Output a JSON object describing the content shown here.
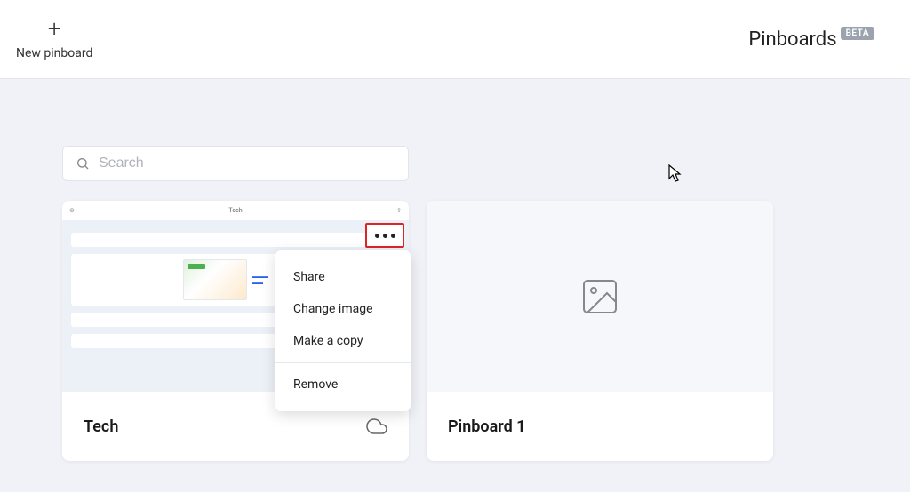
{
  "header": {
    "new_pinboard_label": "New pinboard",
    "title": "Pinboards",
    "badge": "BETA"
  },
  "search": {
    "placeholder": "Search"
  },
  "cards": [
    {
      "title": "Tech",
      "preview_title": "Tech",
      "has_cloud": true
    },
    {
      "title": "Pinboard 1",
      "empty": true
    }
  ],
  "context_menu": {
    "items": [
      "Share",
      "Change image",
      "Make a copy"
    ],
    "remove": "Remove"
  }
}
